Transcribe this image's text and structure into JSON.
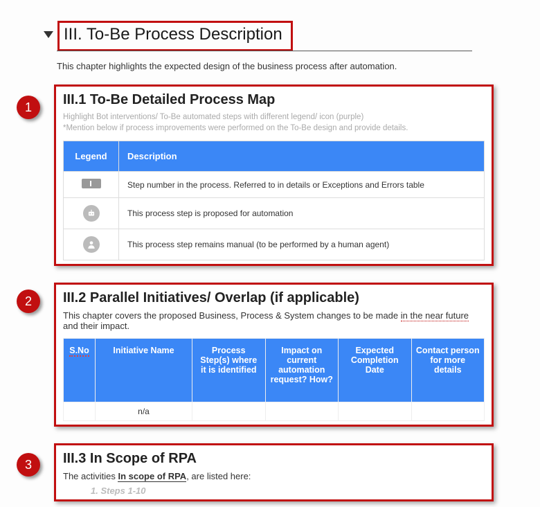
{
  "title": "III.   To-Be Process Description",
  "intro": "This chapter highlights the expected design of the business process after automation.",
  "callouts": {
    "one": "1",
    "two": "2",
    "three": "3"
  },
  "section1": {
    "heading": "III.1 To-Be Detailed Process Map",
    "note1": "Highlight Bot interventions/ To-Be automated steps with different legend/ icon (purple)",
    "note2": "*Mention below if process improvements were performed on the To-Be design and provide details.",
    "headers": {
      "legend": "Legend",
      "description": "Description"
    },
    "rows": {
      "r1": "Step number in the process. Referred to in details or Exceptions and Errors table",
      "r2": "This process step is proposed for automation",
      "r3": "This process step remains manual (to be performed by a human agent)"
    }
  },
  "section2": {
    "heading": "III.2 Parallel Initiatives/ Overlap (if applicable)",
    "desc_pre": "This chapter covers the proposed Business, Process & System changes to be made ",
    "desc_dotted": "in the near future",
    "desc_post": " and their impact.",
    "headers": {
      "sno": "S.No",
      "init": "Initiative Name",
      "process": "Process Step(s) where it is identified",
      "impact": "Impact on current automation request? How?",
      "date": "Expected Completion Date",
      "contact": "Contact person for more details"
    },
    "row": {
      "init": "n/a"
    }
  },
  "section3": {
    "heading": "III.3 In Scope of RPA",
    "line_pre": "The activities ",
    "line_bold": "In scope of RPA",
    "line_post": ", are listed here:",
    "steps": "1.   Steps 1-10"
  }
}
